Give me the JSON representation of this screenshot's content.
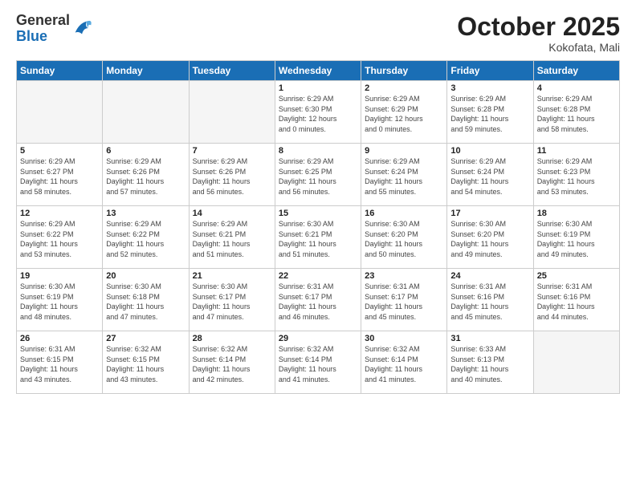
{
  "header": {
    "logo_general": "General",
    "logo_blue": "Blue",
    "month_title": "October 2025",
    "location": "Kokofata, Mali"
  },
  "weekdays": [
    "Sunday",
    "Monday",
    "Tuesday",
    "Wednesday",
    "Thursday",
    "Friday",
    "Saturday"
  ],
  "days": [
    {
      "num": "",
      "info": ""
    },
    {
      "num": "",
      "info": ""
    },
    {
      "num": "",
      "info": ""
    },
    {
      "num": "1",
      "info": "Sunrise: 6:29 AM\nSunset: 6:30 PM\nDaylight: 12 hours\nand 0 minutes."
    },
    {
      "num": "2",
      "info": "Sunrise: 6:29 AM\nSunset: 6:29 PM\nDaylight: 12 hours\nand 0 minutes."
    },
    {
      "num": "3",
      "info": "Sunrise: 6:29 AM\nSunset: 6:28 PM\nDaylight: 11 hours\nand 59 minutes."
    },
    {
      "num": "4",
      "info": "Sunrise: 6:29 AM\nSunset: 6:28 PM\nDaylight: 11 hours\nand 58 minutes."
    },
    {
      "num": "5",
      "info": "Sunrise: 6:29 AM\nSunset: 6:27 PM\nDaylight: 11 hours\nand 58 minutes."
    },
    {
      "num": "6",
      "info": "Sunrise: 6:29 AM\nSunset: 6:26 PM\nDaylight: 11 hours\nand 57 minutes."
    },
    {
      "num": "7",
      "info": "Sunrise: 6:29 AM\nSunset: 6:26 PM\nDaylight: 11 hours\nand 56 minutes."
    },
    {
      "num": "8",
      "info": "Sunrise: 6:29 AM\nSunset: 6:25 PM\nDaylight: 11 hours\nand 56 minutes."
    },
    {
      "num": "9",
      "info": "Sunrise: 6:29 AM\nSunset: 6:24 PM\nDaylight: 11 hours\nand 55 minutes."
    },
    {
      "num": "10",
      "info": "Sunrise: 6:29 AM\nSunset: 6:24 PM\nDaylight: 11 hours\nand 54 minutes."
    },
    {
      "num": "11",
      "info": "Sunrise: 6:29 AM\nSunset: 6:23 PM\nDaylight: 11 hours\nand 53 minutes."
    },
    {
      "num": "12",
      "info": "Sunrise: 6:29 AM\nSunset: 6:22 PM\nDaylight: 11 hours\nand 53 minutes."
    },
    {
      "num": "13",
      "info": "Sunrise: 6:29 AM\nSunset: 6:22 PM\nDaylight: 11 hours\nand 52 minutes."
    },
    {
      "num": "14",
      "info": "Sunrise: 6:29 AM\nSunset: 6:21 PM\nDaylight: 11 hours\nand 51 minutes."
    },
    {
      "num": "15",
      "info": "Sunrise: 6:30 AM\nSunset: 6:21 PM\nDaylight: 11 hours\nand 51 minutes."
    },
    {
      "num": "16",
      "info": "Sunrise: 6:30 AM\nSunset: 6:20 PM\nDaylight: 11 hours\nand 50 minutes."
    },
    {
      "num": "17",
      "info": "Sunrise: 6:30 AM\nSunset: 6:20 PM\nDaylight: 11 hours\nand 49 minutes."
    },
    {
      "num": "18",
      "info": "Sunrise: 6:30 AM\nSunset: 6:19 PM\nDaylight: 11 hours\nand 49 minutes."
    },
    {
      "num": "19",
      "info": "Sunrise: 6:30 AM\nSunset: 6:19 PM\nDaylight: 11 hours\nand 48 minutes."
    },
    {
      "num": "20",
      "info": "Sunrise: 6:30 AM\nSunset: 6:18 PM\nDaylight: 11 hours\nand 47 minutes."
    },
    {
      "num": "21",
      "info": "Sunrise: 6:30 AM\nSunset: 6:17 PM\nDaylight: 11 hours\nand 47 minutes."
    },
    {
      "num": "22",
      "info": "Sunrise: 6:31 AM\nSunset: 6:17 PM\nDaylight: 11 hours\nand 46 minutes."
    },
    {
      "num": "23",
      "info": "Sunrise: 6:31 AM\nSunset: 6:17 PM\nDaylight: 11 hours\nand 45 minutes."
    },
    {
      "num": "24",
      "info": "Sunrise: 6:31 AM\nSunset: 6:16 PM\nDaylight: 11 hours\nand 45 minutes."
    },
    {
      "num": "25",
      "info": "Sunrise: 6:31 AM\nSunset: 6:16 PM\nDaylight: 11 hours\nand 44 minutes."
    },
    {
      "num": "26",
      "info": "Sunrise: 6:31 AM\nSunset: 6:15 PM\nDaylight: 11 hours\nand 43 minutes."
    },
    {
      "num": "27",
      "info": "Sunrise: 6:32 AM\nSunset: 6:15 PM\nDaylight: 11 hours\nand 43 minutes."
    },
    {
      "num": "28",
      "info": "Sunrise: 6:32 AM\nSunset: 6:14 PM\nDaylight: 11 hours\nand 42 minutes."
    },
    {
      "num": "29",
      "info": "Sunrise: 6:32 AM\nSunset: 6:14 PM\nDaylight: 11 hours\nand 41 minutes."
    },
    {
      "num": "30",
      "info": "Sunrise: 6:32 AM\nSunset: 6:14 PM\nDaylight: 11 hours\nand 41 minutes."
    },
    {
      "num": "31",
      "info": "Sunrise: 6:33 AM\nSunset: 6:13 PM\nDaylight: 11 hours\nand 40 minutes."
    },
    {
      "num": "",
      "info": ""
    }
  ]
}
